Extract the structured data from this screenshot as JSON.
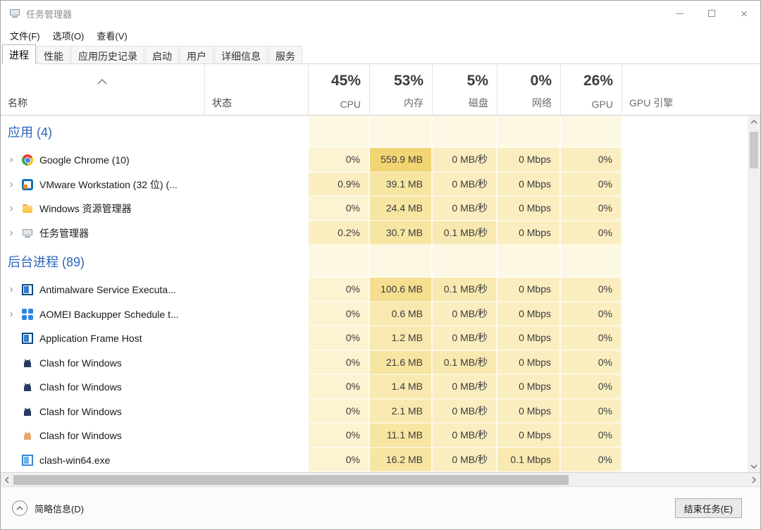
{
  "window": {
    "title": "任务管理器"
  },
  "menu": {
    "items": [
      "文件(F)",
      "选项(O)",
      "查看(V)"
    ]
  },
  "tabs": [
    {
      "label": "进程",
      "active": true
    },
    {
      "label": "性能",
      "active": false
    },
    {
      "label": "应用历史记录",
      "active": false
    },
    {
      "label": "启动",
      "active": false
    },
    {
      "label": "用户",
      "active": false
    },
    {
      "label": "详细信息",
      "active": false
    },
    {
      "label": "服务",
      "active": false
    }
  ],
  "table": {
    "name_header": "名称",
    "status_header": "状态",
    "gpu_engine_header": "GPU 引擎",
    "stat_columns": [
      {
        "usage": "45%",
        "label": "CPU"
      },
      {
        "usage": "53%",
        "label": "内存"
      },
      {
        "usage": "5%",
        "label": "磁盘"
      },
      {
        "usage": "0%",
        "label": "网络"
      },
      {
        "usage": "26%",
        "label": "GPU"
      }
    ],
    "sections": [
      {
        "title": "应用 (4)",
        "rows": [
          {
            "name": "Google Chrome (10)",
            "icon": "chrome",
            "expandable": true,
            "cells": [
              "0%",
              "559.9 MB",
              "0 MB/秒",
              "0 Mbps",
              "0%"
            ],
            "heat": [
              1,
              6,
              2,
              2,
              2
            ]
          },
          {
            "name": "VMware Workstation (32 位) (...",
            "icon": "vmware",
            "expandable": true,
            "cells": [
              "0.9%",
              "39.1 MB",
              "0 MB/秒",
              "0 Mbps",
              "0%"
            ],
            "heat": [
              2,
              4,
              2,
              2,
              2
            ]
          },
          {
            "name": "Windows 资源管理器",
            "icon": "folder",
            "expandable": true,
            "cells": [
              "0%",
              "24.4 MB",
              "0 MB/秒",
              "0 Mbps",
              "0%"
            ],
            "heat": [
              1,
              4,
              2,
              2,
              2
            ]
          },
          {
            "name": "任务管理器",
            "icon": "taskmgr",
            "expandable": true,
            "cells": [
              "0.2%",
              "30.7 MB",
              "0.1 MB/秒",
              "0 Mbps",
              "0%"
            ],
            "heat": [
              2,
              4,
              3,
              2,
              2
            ]
          }
        ]
      },
      {
        "title": "后台进程 (89)",
        "rows": [
          {
            "name": "Antimalware Service Executa...",
            "icon": "window",
            "expandable": true,
            "cells": [
              "0%",
              "100.6 MB",
              "0.1 MB/秒",
              "0 Mbps",
              "0%"
            ],
            "heat": [
              1,
              5,
              3,
              2,
              2
            ]
          },
          {
            "name": "AOMEI Backupper Schedule t...",
            "icon": "aomei",
            "expandable": true,
            "cells": [
              "0%",
              "0.6 MB",
              "0 MB/秒",
              "0 Mbps",
              "0%"
            ],
            "heat": [
              1,
              3,
              2,
              2,
              2
            ]
          },
          {
            "name": "Application Frame Host",
            "icon": "window",
            "expandable": false,
            "cells": [
              "0%",
              "1.2 MB",
              "0 MB/秒",
              "0 Mbps",
              "0%"
            ],
            "heat": [
              1,
              3,
              2,
              2,
              2
            ]
          },
          {
            "name": "Clash for Windows",
            "icon": "cat-dark",
            "expandable": false,
            "cells": [
              "0%",
              "21.6 MB",
              "0.1 MB/秒",
              "0 Mbps",
              "0%"
            ],
            "heat": [
              1,
              4,
              3,
              2,
              2
            ]
          },
          {
            "name": "Clash for Windows",
            "icon": "cat-dark",
            "expandable": false,
            "cells": [
              "0%",
              "1.4 MB",
              "0 MB/秒",
              "0 Mbps",
              "0%"
            ],
            "heat": [
              1,
              3,
              2,
              2,
              2
            ]
          },
          {
            "name": "Clash for Windows",
            "icon": "cat-dark",
            "expandable": false,
            "cells": [
              "0%",
              "2.1 MB",
              "0 MB/秒",
              "0 Mbps",
              "0%"
            ],
            "heat": [
              1,
              3,
              2,
              2,
              2
            ]
          },
          {
            "name": "Clash for Windows",
            "icon": "cat-orange",
            "expandable": false,
            "cells": [
              "0%",
              "11.1 MB",
              "0 MB/秒",
              "0 Mbps",
              "0%"
            ],
            "heat": [
              1,
              4,
              2,
              2,
              2
            ]
          },
          {
            "name": "clash-win64.exe",
            "icon": "window-light",
            "expandable": false,
            "cells": [
              "0%",
              "16.2 MB",
              "0 MB/秒",
              "0.1 Mbps",
              "0%"
            ],
            "heat": [
              1,
              4,
              2,
              3,
              2
            ]
          }
        ]
      }
    ]
  },
  "footer": {
    "details_toggle": "简略信息(D)",
    "end_task_button": "结束任务(E)"
  },
  "colors": {
    "heat_scale": [
      "#fdf8e4",
      "#fcf3d2",
      "#faeec1",
      "#f8e9b1",
      "#f7e5a2",
      "#f6de90",
      "#f2d572"
    ],
    "section_title": "#2a64b8",
    "accent_blue": "#2f7cd0"
  }
}
